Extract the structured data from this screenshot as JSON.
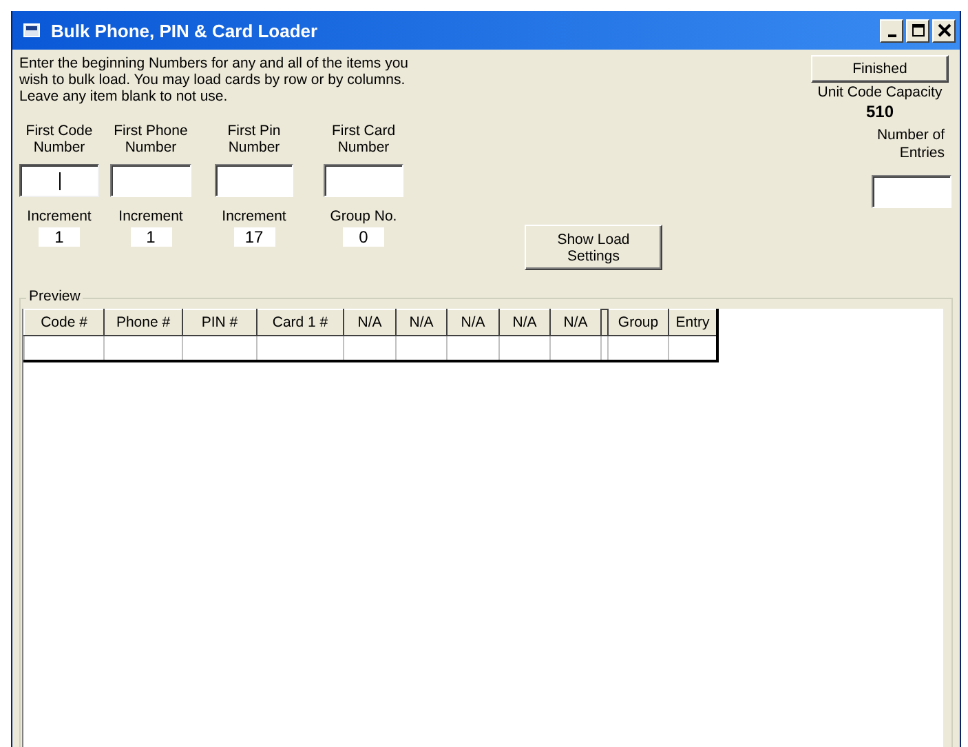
{
  "window": {
    "title": "Bulk Phone, PIN & Card Loader"
  },
  "instructions": "Enter the beginning Numbers for any and all of the items you wish to bulk load.  You may load cards by row or by columns.  Leave any item blank to not use.",
  "fields": [
    {
      "label": "First Code Number",
      "focused": true,
      "sub_label": "Increment",
      "sub_value": "1"
    },
    {
      "label": "First Phone Number",
      "focused": false,
      "sub_label": "Increment",
      "sub_value": "1"
    },
    {
      "label": "First Pin Number",
      "focused": false,
      "sub_label": "Increment",
      "sub_value": "17"
    },
    {
      "label": "First Card Number",
      "focused": false,
      "sub_label": "Group No.",
      "sub_value": "0"
    }
  ],
  "show_load_button": "Show Load Settings",
  "finished_button": "Finished",
  "capacity": {
    "label": "Unit Code Capacity",
    "value": "510"
  },
  "entries": {
    "label": "Number of Entries"
  },
  "preview": {
    "title": "Preview",
    "columns": [
      {
        "label": "Code #"
      },
      {
        "label": "Phone #"
      },
      {
        "label": "PIN #"
      },
      {
        "label": "Card 1 #"
      },
      {
        "label": "N/A"
      },
      {
        "label": "N/A"
      },
      {
        "label": "N/A"
      },
      {
        "label": "N/A"
      },
      {
        "label": "N/A"
      },
      {
        "label": "Group"
      },
      {
        "label": "Entry"
      }
    ]
  }
}
